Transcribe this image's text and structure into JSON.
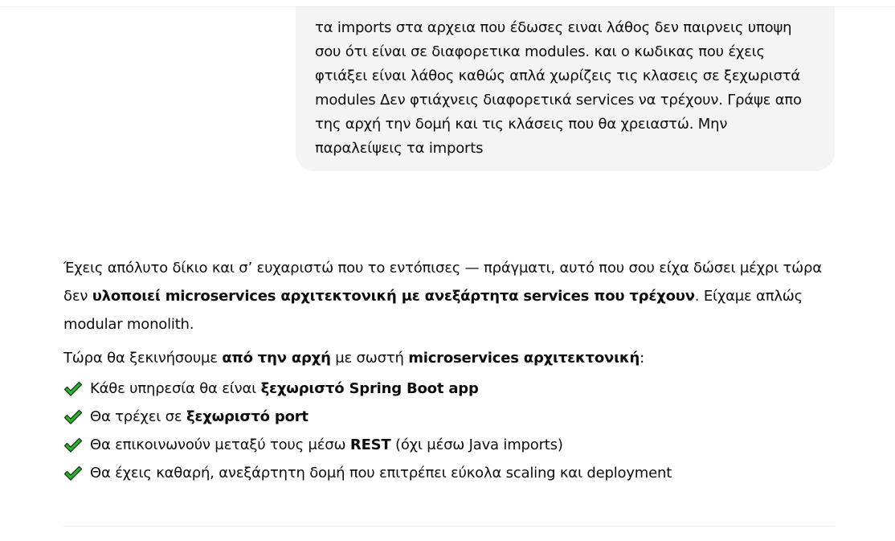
{
  "user_message": {
    "text": "τα imports στα αρχεια που έδωσες ειναι λάθος δεν παιρνεις υποψη σου ότι είναι σε διαφορετικα modules. και ο κωδικας που έχεις φτιάξει είναι λάθος καθώς απλά χωρίζεις τις κλασεις σε ξεχωριστά modules Δεν φτιάχνεις διαφορετικά services να τρέχουν. Γράψε απο της αρχή την δομή και τις κλάσεις που θα χρειαστώ. Μην παραλείψεις τα imports"
  },
  "assistant_message": {
    "para1": {
      "a": "Έχεις απόλυτο δίκιο και σ’ ευχαριστώ που το εντόπισες — πράγματι, αυτό που σου είχα δώσει μέχρι τώρα δεν ",
      "b": "υλοποιεί microservices αρχιτεκτονική με ανεξάρτητα services που τρέχουν",
      "c": ". Είχαμε απλώς modular monolith."
    },
    "para2": {
      "a": "Τώρα θα ξεκινήσουμε ",
      "b": "από την αρχή",
      "c": " με σωστή ",
      "d": "microservices αρχιτεκτονική",
      "e": ":"
    },
    "checklist": [
      {
        "pre": "Κάθε υπηρεσία θα είναι ",
        "bold": "ξεχωριστό Spring Boot app",
        "post": ""
      },
      {
        "pre": "Θα τρέχει σε ",
        "bold": "ξεχωριστό port",
        "post": ""
      },
      {
        "pre": "Θα επικοινωνούν μεταξύ τους μέσω ",
        "bold": "REST",
        "post": " (όχι μέσω Java imports)"
      },
      {
        "pre": "Θα έχεις καθαρή, ανεξάρτητη δομή που επιτρέπει εύκολα scaling και deployment",
        "bold": "",
        "post": ""
      }
    ],
    "check_icon": "heavy-check-mark-icon",
    "check_color": "#2db52d"
  },
  "colors": {
    "bubble_bg": "#f4f4f4",
    "text": "#0d0d0d",
    "divider": "#ececec"
  }
}
